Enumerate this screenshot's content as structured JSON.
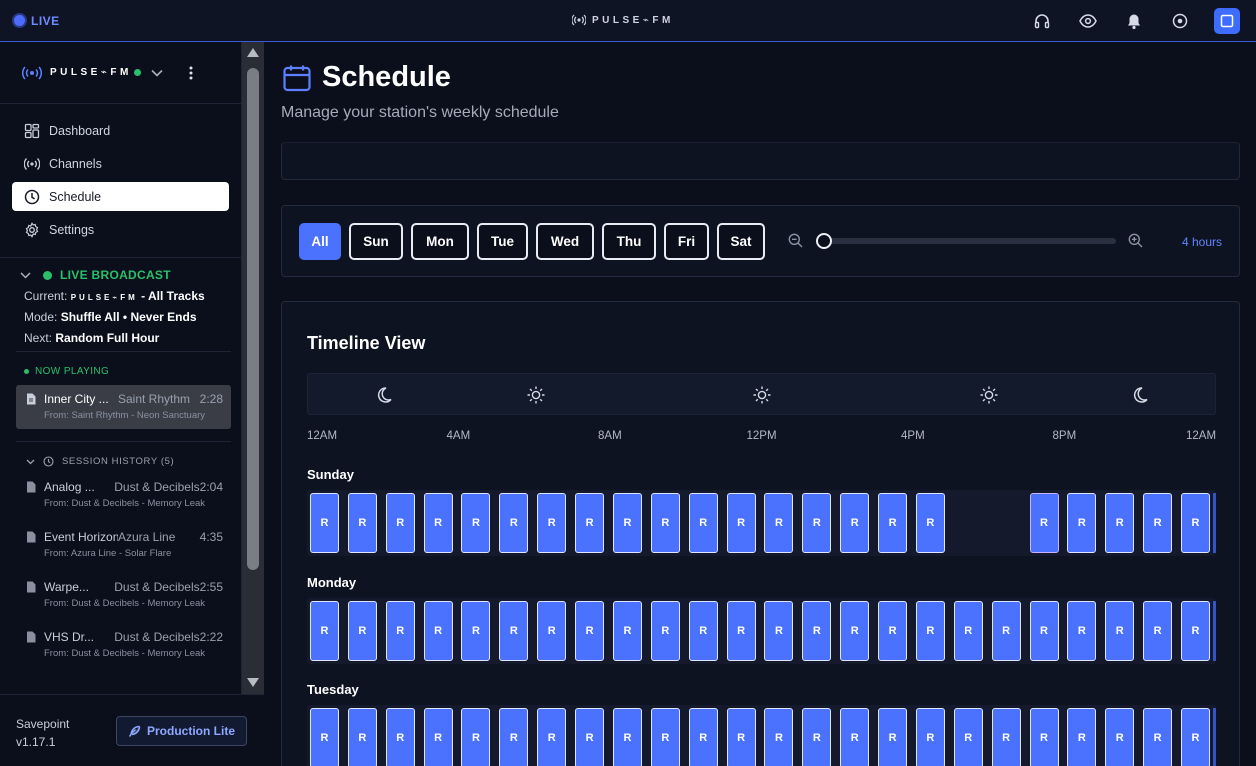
{
  "topbar": {
    "live_label": "LIVE",
    "brand": "PULSE⌁FM",
    "icons": [
      "headphones-icon",
      "eye-icon",
      "bell-icon",
      "target-icon",
      "square-icon"
    ]
  },
  "sidebar": {
    "brand": "PULSE⌁FM",
    "nav": [
      {
        "label": "Dashboard",
        "icon": "dashboard-icon"
      },
      {
        "label": "Channels",
        "icon": "broadcast-icon"
      },
      {
        "label": "Schedule",
        "icon": "clock-icon",
        "active": true
      },
      {
        "label": "Settings",
        "icon": "gear-icon"
      }
    ],
    "broadcast": {
      "title": "LIVE BROADCAST",
      "current_label": "Current:",
      "current_brand": "PULSE⌁FM",
      "current_value": "- All Tracks",
      "mode_label": "Mode:",
      "mode_value": "Shuffle All • Never Ends",
      "next_label": "Next:",
      "next_value": "Random Full Hour"
    },
    "now_playing_label": "NOW PLAYING",
    "now_playing": {
      "title": "Inner City ...",
      "artist": "Saint Rhythm",
      "duration": "2:28",
      "from": "From: Saint Rhythm - Neon Sanctuary"
    },
    "history_label": "SESSION HISTORY (5)",
    "history": [
      {
        "title": "Analog ...",
        "artist": "Dust & Decibels",
        "duration": "2:04",
        "from": "From: Dust & Decibels - Memory Leak"
      },
      {
        "title": "Event Horizon",
        "artist": "Azura Line",
        "duration": "4:35",
        "from": "From: Azura Line - Solar Flare"
      },
      {
        "title": "Warpe...",
        "artist": "Dust & Decibels",
        "duration": "2:55",
        "from": "From: Dust & Decibels - Memory Leak"
      },
      {
        "title": "VHS Dr...",
        "artist": "Dust & Decibels",
        "duration": "2:22",
        "from": "From: Dust & Decibels - Memory Leak"
      }
    ],
    "footer": {
      "app_name": "Savepoint",
      "version": "v1.17.1",
      "plan_button": "Production Lite"
    }
  },
  "main": {
    "title": "Schedule",
    "subtitle": "Manage your station's weekly schedule",
    "day_filters": [
      "All",
      "Sun",
      "Mon",
      "Tue",
      "Wed",
      "Thu",
      "Fri",
      "Sat"
    ],
    "active_filter": "All",
    "zoom_label": "4 hours",
    "zoom_level": 0,
    "timeline": {
      "title": "Timeline View",
      "period_icons": [
        "moon-icon",
        "sun-icon",
        "sun-icon",
        "sun-icon",
        "moon-icon"
      ],
      "hour_labels": [
        "12AM",
        "4AM",
        "8AM",
        "12PM",
        "4PM",
        "8PM",
        "12AM"
      ],
      "slot_label": "R",
      "days": [
        {
          "name": "Sunday",
          "filled_hours": [
            0,
            1,
            2,
            3,
            4,
            5,
            6,
            7,
            8,
            9,
            10,
            11,
            12,
            13,
            14,
            15,
            16,
            19,
            20,
            21,
            22,
            23
          ]
        },
        {
          "name": "Monday",
          "filled_hours": [
            0,
            1,
            2,
            3,
            4,
            5,
            6,
            7,
            8,
            9,
            10,
            11,
            12,
            13,
            14,
            15,
            16,
            17,
            18,
            19,
            20,
            21,
            22,
            23
          ]
        },
        {
          "name": "Tuesday",
          "filled_hours": [
            0,
            1,
            2,
            3,
            4,
            5,
            6,
            7,
            8,
            9,
            10,
            11,
            12,
            13,
            14,
            15,
            16,
            17,
            18,
            19,
            20,
            21,
            22,
            23
          ]
        }
      ]
    }
  },
  "colors": {
    "accent": "#4a72ff",
    "live_green": "#28c06a",
    "background": "#0b0f1c"
  }
}
